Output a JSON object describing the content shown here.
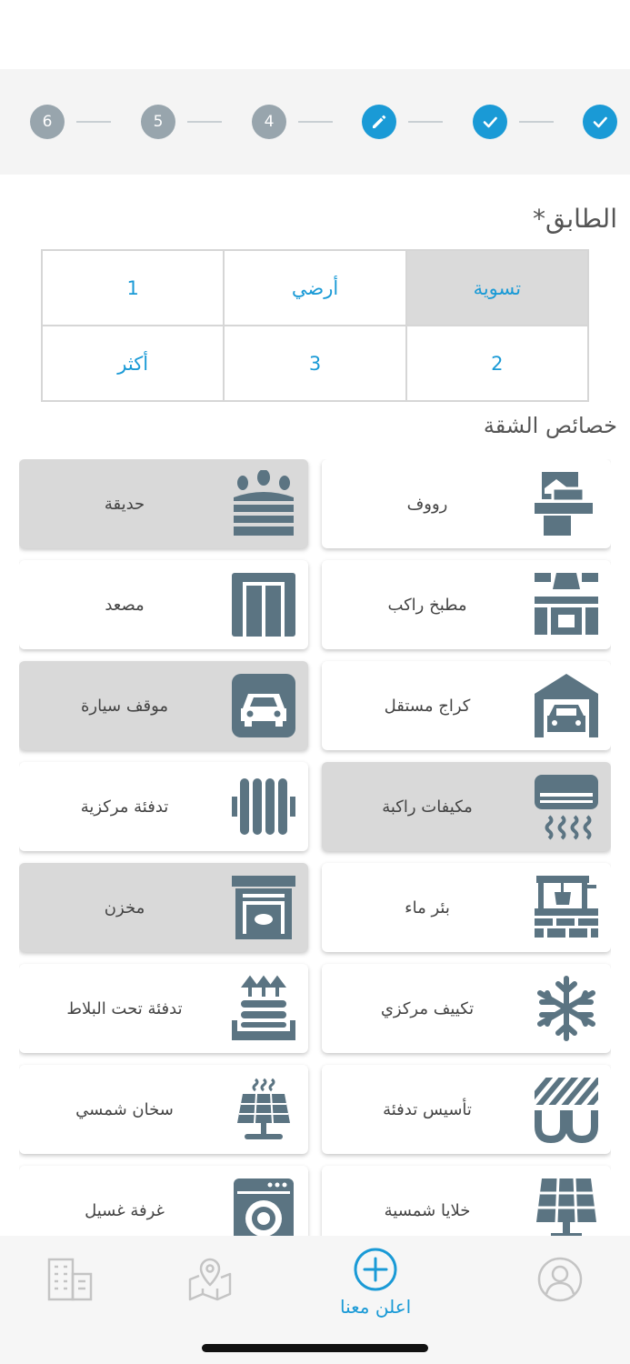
{
  "steps": [
    {
      "label": "",
      "state": "done",
      "icon": "check-icon"
    },
    {
      "label": "",
      "state": "done",
      "icon": "check-icon"
    },
    {
      "label": "",
      "state": "current",
      "icon": "pencil-icon"
    },
    {
      "label": "4",
      "state": "pending"
    },
    {
      "label": "5",
      "state": "pending"
    },
    {
      "label": "6",
      "state": "pending"
    }
  ],
  "floor": {
    "title": "الطابق*",
    "options": [
      {
        "label": "تسوية",
        "selected": true
      },
      {
        "label": "أرضي",
        "selected": false
      },
      {
        "label": "1",
        "selected": false
      },
      {
        "label": "2",
        "selected": false
      },
      {
        "label": "3",
        "selected": false
      },
      {
        "label": "أكثر",
        "selected": false
      }
    ]
  },
  "features": {
    "title": "خصائص الشقة",
    "items": [
      {
        "label": "رووف",
        "icon": "roof-icon",
        "selected": false
      },
      {
        "label": "حديقة",
        "icon": "garden-icon",
        "selected": true
      },
      {
        "label": "مطبخ راكب",
        "icon": "kitchen-icon",
        "selected": false
      },
      {
        "label": "مصعد",
        "icon": "elevator-icon",
        "selected": false
      },
      {
        "label": "كراج مستقل",
        "icon": "garage-icon",
        "selected": false
      },
      {
        "label": "موقف سيارة",
        "icon": "parking-icon",
        "selected": true
      },
      {
        "label": "مكيفات راكبة",
        "icon": "air-conditioner-icon",
        "selected": true
      },
      {
        "label": "تدفئة مركزية",
        "icon": "radiator-icon",
        "selected": false
      },
      {
        "label": "بئر ماء",
        "icon": "water-well-icon",
        "selected": false
      },
      {
        "label": "مخزن",
        "icon": "storage-icon",
        "selected": true
      },
      {
        "label": "تكييف مركزي",
        "icon": "snowflake-icon",
        "selected": false
      },
      {
        "label": "تدفئة تحت البلاط",
        "icon": "floor-heating-icon",
        "selected": false
      },
      {
        "label": "تأسيس تدفئة",
        "icon": "heating-pipes-icon",
        "selected": false
      },
      {
        "label": "سخان شمسي",
        "icon": "solar-heater-icon",
        "selected": false
      },
      {
        "label": "خلايا شمسية",
        "icon": "solar-panel-icon",
        "selected": false
      },
      {
        "label": "غرفة غسيل",
        "icon": "washing-machine-icon",
        "selected": false
      }
    ]
  },
  "nav": {
    "advertise_label": "اعلن معنا"
  },
  "colors": {
    "accent": "#1a9ad6",
    "icon": "#5b7482",
    "pending_step": "#98a5ad",
    "selected_bg": "#d9d9d9"
  }
}
